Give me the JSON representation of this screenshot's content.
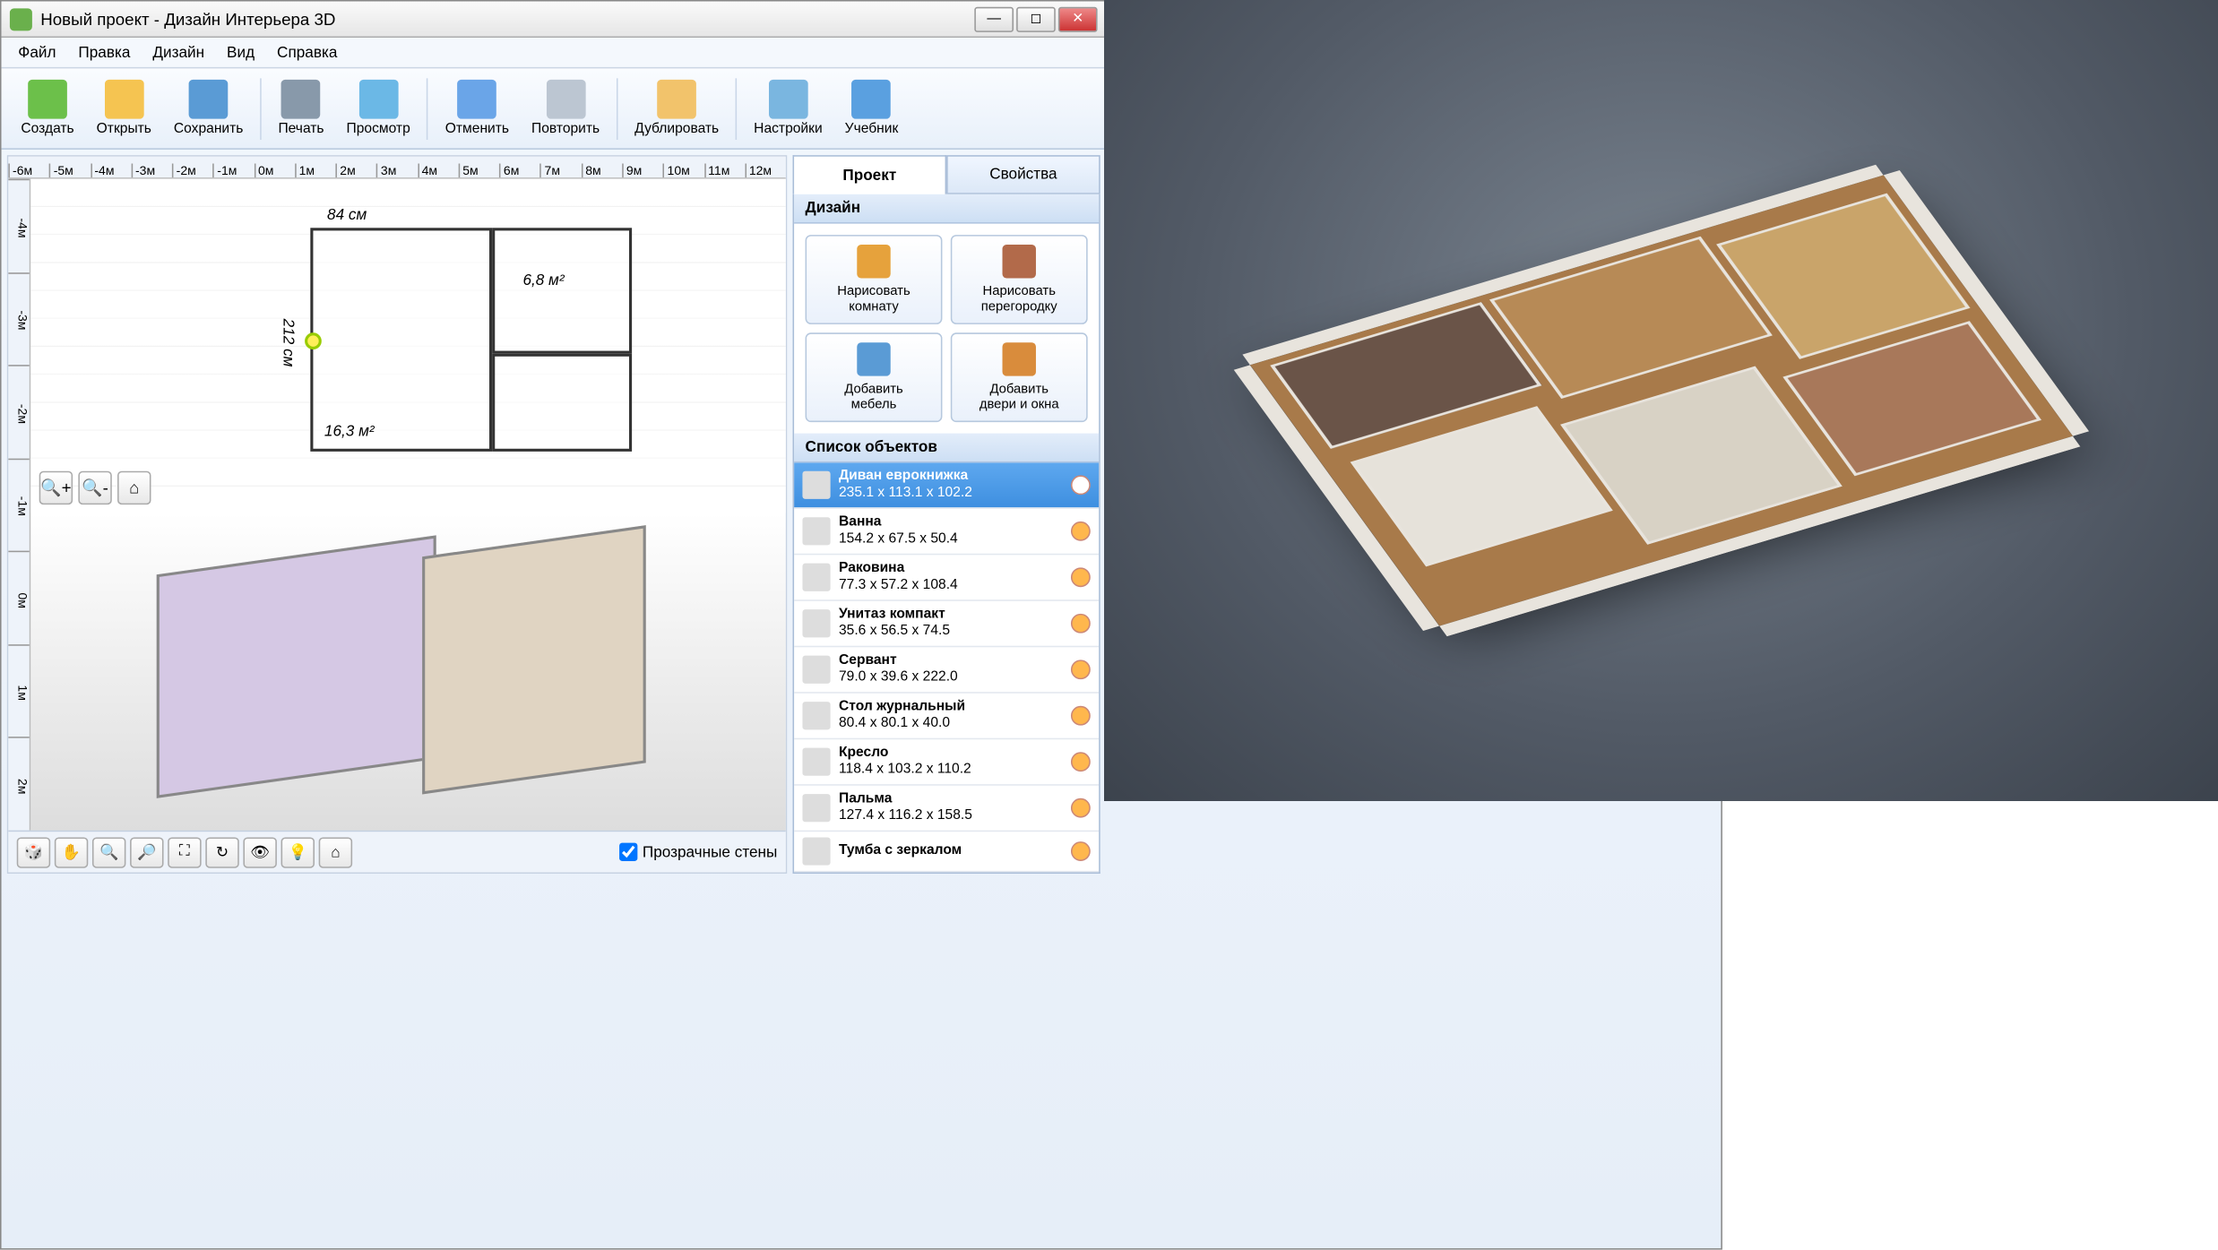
{
  "window": {
    "title": "Новый проект - Дизайн Интерьера 3D"
  },
  "menu": [
    "Файл",
    "Правка",
    "Дизайн",
    "Вид",
    "Справка"
  ],
  "toolbar": [
    {
      "id": "create",
      "label": "Создать",
      "color": "#6cc04a"
    },
    {
      "id": "open",
      "label": "Открыть",
      "color": "#f5c451"
    },
    {
      "id": "save",
      "label": "Сохранить",
      "color": "#5a9bd5"
    },
    {
      "sep": true
    },
    {
      "id": "print",
      "label": "Печать",
      "color": "#8899aa"
    },
    {
      "id": "view",
      "label": "Просмотр",
      "color": "#6bb8e6"
    },
    {
      "sep": true
    },
    {
      "id": "undo",
      "label": "Отменить",
      "color": "#6aa5e8"
    },
    {
      "id": "redo",
      "label": "Повторить",
      "color": "#bcc6d2"
    },
    {
      "sep": true
    },
    {
      "id": "duplicate",
      "label": "Дублировать",
      "color": "#f2c36b"
    },
    {
      "sep": true
    },
    {
      "id": "settings",
      "label": "Настройки",
      "color": "#7ab6e0"
    },
    {
      "id": "tutorial",
      "label": "Учебник",
      "color": "#5aa0e0"
    }
  ],
  "ruler_h": [
    "-6м",
    "-5м",
    "-4м",
    "-3м",
    "-2м",
    "-1м",
    "0м",
    "1м",
    "2м",
    "3м",
    "4м",
    "5м",
    "6м",
    "7м",
    "8м",
    "9м",
    "10м",
    "11м",
    "12м"
  ],
  "ruler_v": [
    "-4м",
    "-3м",
    "-2м",
    "-1м",
    "0м",
    "1м",
    "2м"
  ],
  "plan": {
    "room1_area": "16,3 м²",
    "room2_area": "6,8 м²",
    "dim_h": "84 см",
    "dim_v": "212 см"
  },
  "bottom_buttons": [
    "rotate3d",
    "pan",
    "zoom-in",
    "zoom-out",
    "fit",
    "orbit",
    "walk",
    "light",
    "home"
  ],
  "transparent_walls": "Прозрачные стены",
  "tabs": {
    "project": "Проект",
    "properties": "Свойства"
  },
  "sections": {
    "design": "Дизайн",
    "objects": "Список объектов"
  },
  "design_buttons": [
    {
      "id": "draw-room",
      "l1": "Нарисовать",
      "l2": "комнату",
      "c": "#e6a23c"
    },
    {
      "id": "draw-wall",
      "l1": "Нарисовать",
      "l2": "перегородку",
      "c": "#b26a4a"
    },
    {
      "id": "add-furniture",
      "l1": "Добавить",
      "l2": "мебель",
      "c": "#5a9bd5"
    },
    {
      "id": "add-doors",
      "l1": "Добавить",
      "l2": "двери и окна",
      "c": "#d98c3c"
    }
  ],
  "objects": [
    {
      "name": "Диван еврокнижка",
      "dims": "235.1 x 113.1 x 102.2",
      "selected": true
    },
    {
      "name": "Ванна",
      "dims": "154.2 x 67.5 x 50.4"
    },
    {
      "name": "Раковина",
      "dims": "77.3 x 57.2 x 108.4"
    },
    {
      "name": "Унитаз компакт",
      "dims": "35.6 x 56.5 x 74.5"
    },
    {
      "name": "Сервант",
      "dims": "79.0 x 39.6 x 222.0"
    },
    {
      "name": "Стол журнальный",
      "dims": "80.4 x 80.1 x 40.0"
    },
    {
      "name": "Кресло",
      "dims": "118.4 x 103.2 x 110.2"
    },
    {
      "name": "Пальма",
      "dims": "127.4 x 116.2 x 158.5"
    },
    {
      "name": "Тумба с зеркалом",
      "dims": ""
    }
  ]
}
